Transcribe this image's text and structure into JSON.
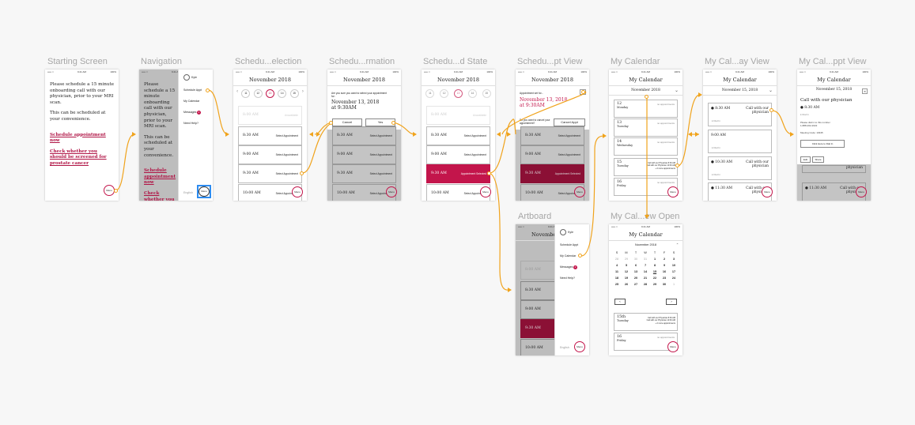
{
  "titles": {
    "starting": "Starting Screen",
    "navigation": "Navigation",
    "selection": "Schedu...election",
    "confirmation": "Schedu...rmation",
    "state": "Schedu...d State",
    "apptview": "Schedu...pt View",
    "mycal": "My Calendar",
    "dayview": "My Cal...ay View",
    "pptview": "My Cal...ppt View",
    "artboard": "Artboard",
    "viewopen": "My Cal...ew Open"
  },
  "status": {
    "carrier": "••••• ≈",
    "time": "9:41 AM",
    "battery": "100%"
  },
  "common": {
    "menu": "Menu",
    "month": "November 2018",
    "my_calendar": "My Calendar",
    "nov15": "November 15, 2018",
    "select_appt": "Select Appointment",
    "appt_selected": "Appointment Selected",
    "unavailable": "Unavailable",
    "slots": [
      "8:30 AM",
      "9:00 AM",
      "9:30 AM",
      "10:00 AM"
    ]
  },
  "start": {
    "line1": "Please schedule a 15 minute onboarding call with our physician, prior to your MRI scan.",
    "line2": "This can be scheduled at your convenience.",
    "link1": "Schedule appointment now",
    "link2": "Check whether you should be screened for prostate cancer"
  },
  "drawer": {
    "user": "Kyle",
    "items": [
      "Schedule Appt",
      "My Calendar",
      "Messages",
      "Need Help?"
    ],
    "badge": "2",
    "lang": "English"
  },
  "days": [
    {
      "n": "11",
      "d": "Sunday"
    },
    {
      "n": "12",
      "d": "Monday"
    },
    {
      "n": "13",
      "d": "Tuesday"
    },
    {
      "n": "14",
      "d": "Wednesday"
    },
    {
      "n": "15",
      "d": "Thursday"
    }
  ],
  "confirm": {
    "question": "Are you sure you want to select your appointment for:",
    "date": "November 13, 2018",
    "time": "at 9:30AM",
    "cancel": "Cancel",
    "yes": "Yes"
  },
  "apptview": {
    "intro": "Appointment set for...",
    "date": "November 13, 2018",
    "time": "at 9:30AM",
    "question": "Do you want to cancel your appointment?",
    "cancel_btn": "Cancel Appt"
  },
  "mycal": {
    "dates": [
      {
        "n": "12",
        "d": "Monday"
      },
      {
        "n": "13",
        "d": "Tuesday"
      },
      {
        "n": "14",
        "d": "Wednesday"
      },
      {
        "n": "15",
        "d": "Tuesday"
      },
      {
        "n": "16",
        "d": "Friday"
      }
    ],
    "empty": "no appointments",
    "appts": [
      "Call with our Physician   8:30 AM",
      "Call with our Physician   10:30 AM",
      "+ 2 more appointments"
    ]
  },
  "dayview": {
    "slots": [
      {
        "time": "8:30 AM",
        "title": "Call with our physician",
        "action": "Dial In"
      },
      {
        "time": "9:00 AM",
        "title": "",
        "action": "Dial In"
      },
      {
        "time": "9:30 AM",
        "title": "",
        "action": "Dial In"
      },
      {
        "time": "10:30 AM",
        "title": "Call with our physician",
        "action": "Dial In"
      },
      {
        "time": "11:30 AM",
        "title": "Call with our physician",
        "action": ""
      }
    ]
  },
  "pptview": {
    "title": "Call with our physician",
    "time": "8:30 AM",
    "dial": "Dial In",
    "instruction": "Please dial in to this number",
    "phone": "1-888-202-2022",
    "code": "Meeting Code: 10345",
    "btn": "Click Here to Dial In",
    "edit": "Edit",
    "share": "Share",
    "bg_time": "11:30 AM"
  },
  "calopen": {
    "weekdays": [
      "S",
      "M",
      "T",
      "W",
      "T",
      "F",
      "S"
    ],
    "rows": [
      [
        "28",
        "29",
        "30",
        "31",
        "1",
        "2",
        "3"
      ],
      [
        "4",
        "5",
        "6",
        "7",
        "8",
        "9",
        "10"
      ],
      [
        "11",
        "12",
        "13",
        "14",
        "15",
        "16",
        "17"
      ],
      [
        "18",
        "19",
        "20",
        "21",
        "22",
        "23",
        "24"
      ],
      [
        "25",
        "26",
        "27",
        "28",
        "29",
        "30",
        "1"
      ]
    ],
    "item1": {
      "n": "15th",
      "d": "Tuesday"
    },
    "item2": {
      "n": "16",
      "d": "Friday"
    }
  },
  "colors": {
    "accent": "#c3154b",
    "wire": "#f0a31c",
    "overlay": "#c4c4c4",
    "selected": "#c3154b"
  }
}
